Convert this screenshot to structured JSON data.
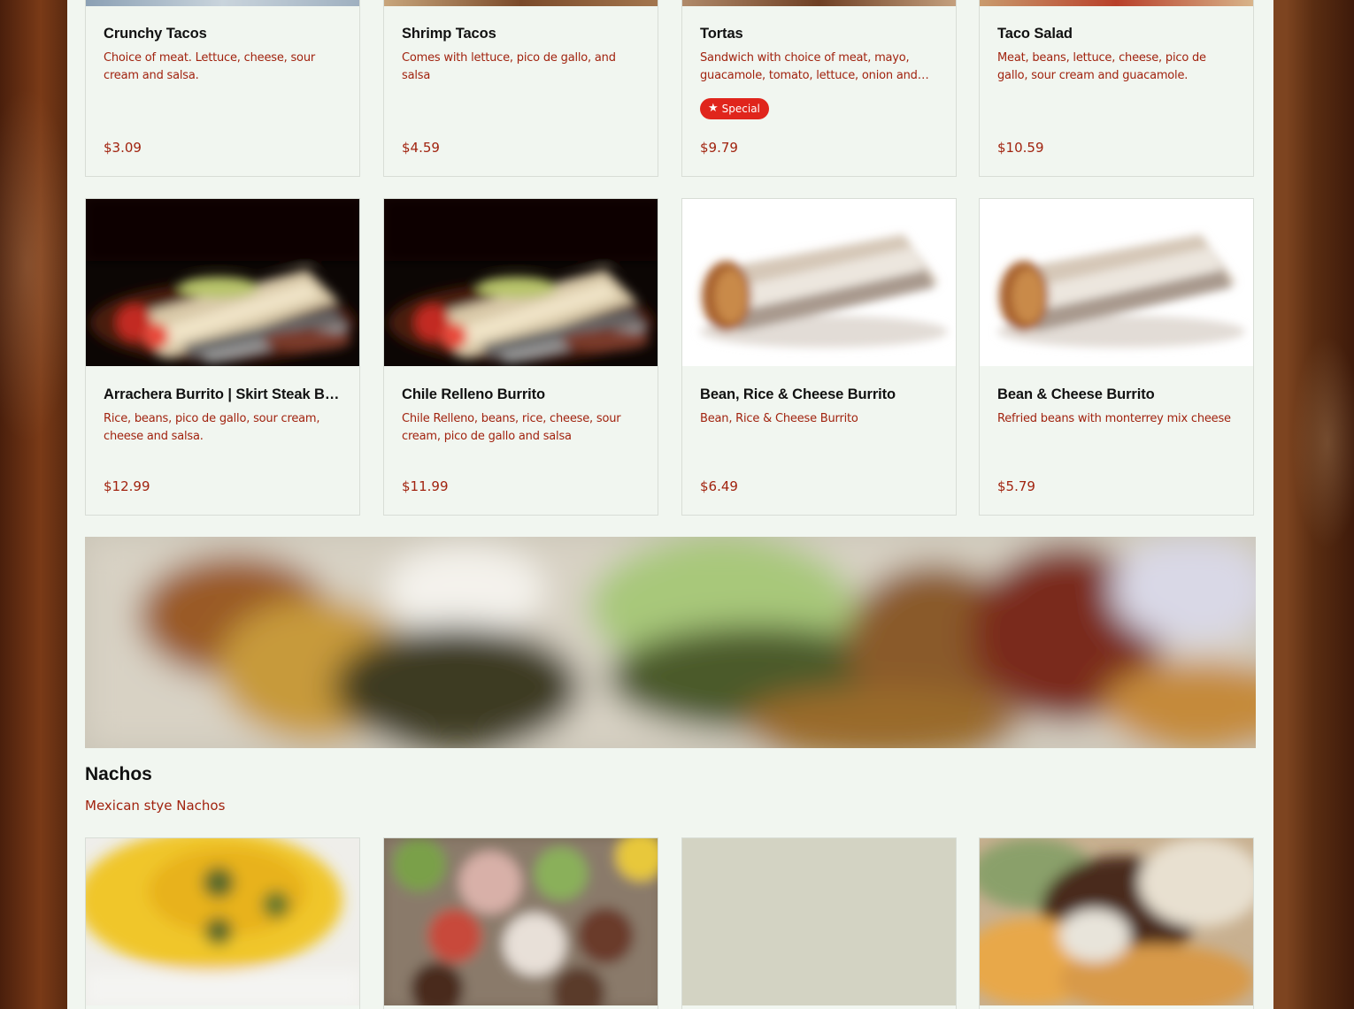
{
  "colors": {
    "accent_text": "#a1230f",
    "badge_bg": "#e0251c",
    "sheet_bg": "#f1f6f0",
    "title_text": "#111111"
  },
  "row1": [
    {
      "title": "Crunchy Tacos",
      "description": "Choice of meat. Lettuce, cheese, sour cream and salsa.",
      "price": "$3.09"
    },
    {
      "title": "Shrimp Tacos",
      "description": "Comes with lettuce, pico de gallo, and salsa",
      "price": "$4.59"
    },
    {
      "title": "Tortas",
      "description": "Sandwich with choice of meat, mayo, guacamole, tomato, lettuce, onion and jalapeños",
      "badge": "Special",
      "badge_icon": "star-icon",
      "price": "$9.79"
    },
    {
      "title": "Taco Salad",
      "description": "Meat, beans, lettuce, cheese, pico de gallo, sour cream and guacamole.",
      "price": "$10.59"
    }
  ],
  "row2": [
    {
      "title": "Arrachera Burrito | Skirt Steak Burrito",
      "description": "Rice, beans, pico de gallo, sour cream, cheese and salsa.",
      "price": "$12.99"
    },
    {
      "title": "Chile Relleno Burrito",
      "description": "Chile Relleno, beans, rice, cheese, sour cream, pico de gallo and salsa",
      "price": "$11.99"
    },
    {
      "title": "Bean, Rice & Cheese Burrito",
      "description": "Bean, Rice & Cheese Burrito",
      "price": "$6.49"
    },
    {
      "title": "Bean & Cheese Burrito",
      "description": "Refried beans with monterrey mix cheese",
      "price": "$5.79"
    }
  ],
  "section": {
    "title": "Nachos",
    "description": "Mexican stye Nachos"
  }
}
